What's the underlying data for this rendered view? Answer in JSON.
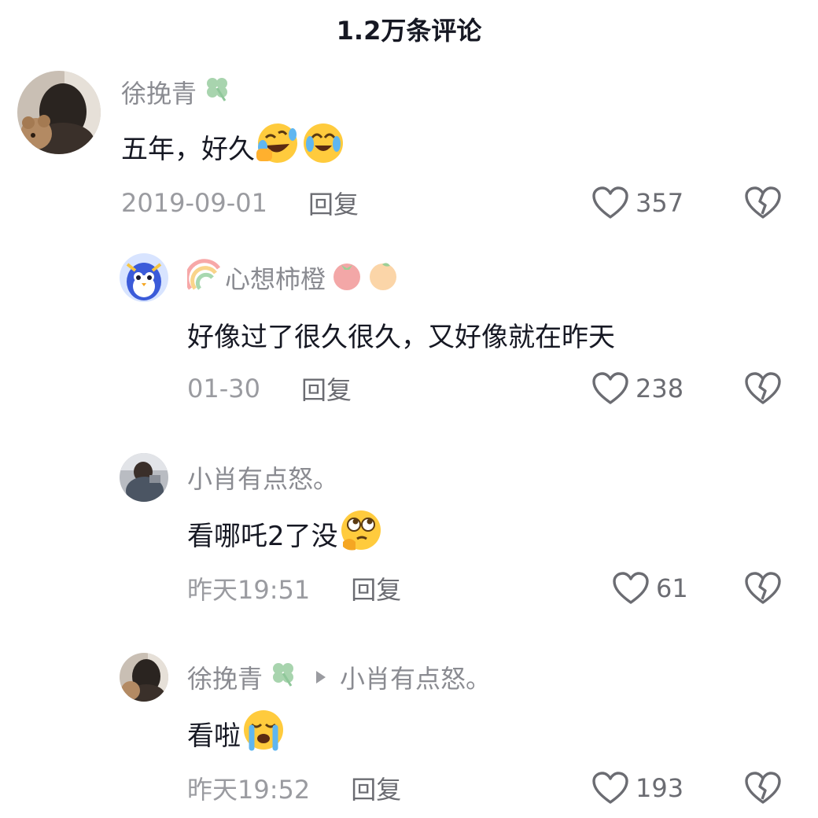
{
  "header": {
    "title": "1.2万条评论"
  },
  "icons": {
    "like": "heart-outline-icon",
    "dislike": "broken-heart-icon",
    "clover": "four-leaf-clover-icon",
    "reply_arrow": "triangle-right-icon"
  },
  "colors": {
    "text_primary": "#161823",
    "text_secondary": "#8a8b91",
    "text_meta": "#9a9ba0",
    "clover": "#8fc79a"
  },
  "comments": [
    {
      "user": "徐挽青",
      "text": "五年，好久",
      "emojis": [
        "rolling-laughing-emoji",
        "crying-laughing-emoji"
      ],
      "date": "2019-09-01",
      "reply_label": "回复",
      "likes": "357"
    },
    {
      "user": "心想柿橙",
      "name_prefix_icon": "rainbow-icon",
      "name_suffix_icons": [
        "tomato-icon",
        "orange-icon"
      ],
      "text": "好像过了很久很久，又好像就在昨天",
      "date": "01-30",
      "reply_label": "回复",
      "likes": "238"
    },
    {
      "user": "小肖有点怒。",
      "text": "看哪吒2了没",
      "emojis": [
        "thinking-rolling-eyes-emoji"
      ],
      "date": "昨天19:51",
      "reply_label": "回复",
      "likes": "61"
    },
    {
      "user": "徐挽青",
      "reply_to": "小肖有点怒。",
      "text": "看啦",
      "emojis": [
        "crying-emoji"
      ],
      "date": "昨天19:52",
      "reply_label": "回复",
      "likes": "193"
    }
  ]
}
